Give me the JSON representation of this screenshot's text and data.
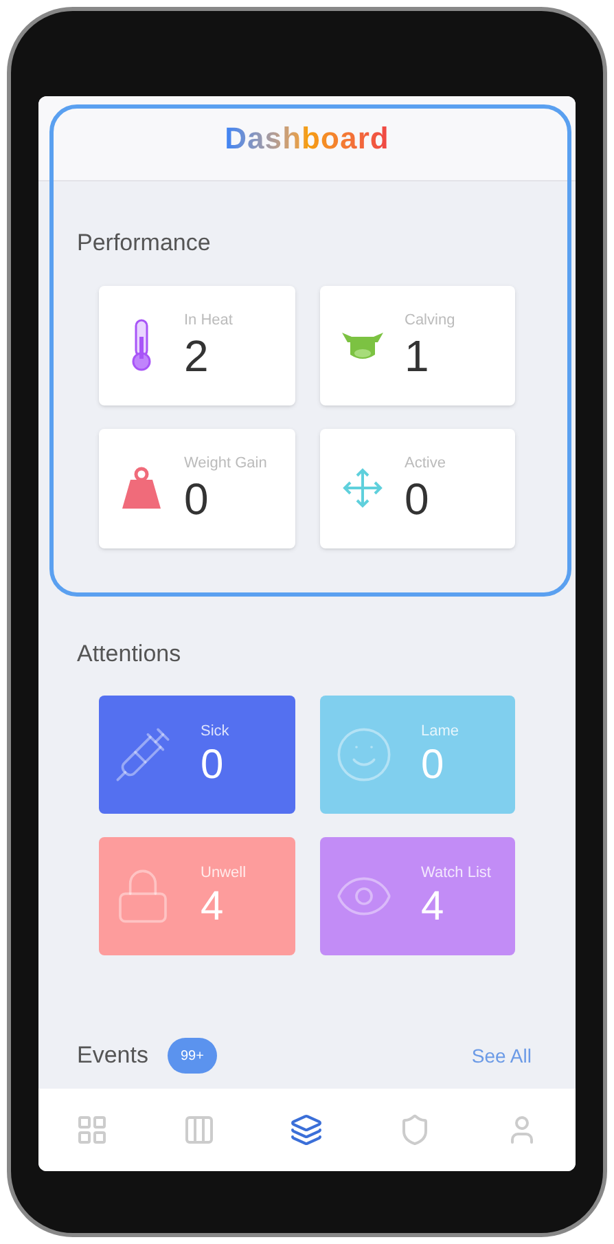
{
  "header": {
    "title": "Dashboard"
  },
  "performance": {
    "title": "Performance",
    "cards": [
      {
        "label": "In Heat",
        "value": "2"
      },
      {
        "label": "Calving",
        "value": "1"
      },
      {
        "label": "Weight Gain",
        "value": "0"
      },
      {
        "label": "Active",
        "value": "0"
      }
    ]
  },
  "attentions": {
    "title": "Attentions",
    "cards": [
      {
        "label": "Sick",
        "value": "0",
        "color": "#5470f0"
      },
      {
        "label": "Lame",
        "value": "0",
        "color": "#80cfee"
      },
      {
        "label": "Unwell",
        "value": "4",
        "color": "#fd9c9c"
      },
      {
        "label": "Watch List",
        "value": "4",
        "color": "#c28cf6"
      }
    ]
  },
  "events": {
    "title": "Events",
    "badge": "99+",
    "link": "See All"
  },
  "nav": [
    {
      "selected": false
    },
    {
      "selected": false
    },
    {
      "selected": true
    },
    {
      "selected": false
    },
    {
      "selected": false
    }
  ]
}
